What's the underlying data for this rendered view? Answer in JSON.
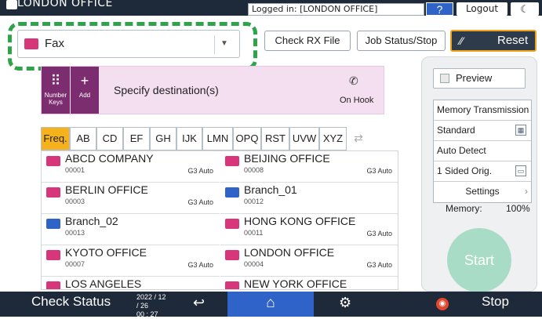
{
  "topbar": {
    "office_label": "LONDON OFFICE",
    "logged_in": "Logged in: [LONDON OFFICE]",
    "help": "?",
    "logout": "Logout",
    "moon": "☾"
  },
  "func_select": {
    "label": "Fax",
    "caret": "▼"
  },
  "buttons": {
    "check_rx": "Check RX File",
    "job_status": "Job Status/Stop",
    "reset": "Reset",
    "reset_icon": "⁄⁄"
  },
  "dest_header": {
    "numkeys_label": "Number Keys",
    "add_label": "Add",
    "specify": "Specify destination(s)",
    "onhook": "On Hook",
    "phone_icon": "✆"
  },
  "tabs": [
    "Freq.",
    "AB",
    "CD",
    "EF",
    "GH",
    "IJK",
    "LMN",
    "OPQ",
    "RST",
    "UVW",
    "XYZ"
  ],
  "tab_swap": "⇄",
  "destinations": [
    {
      "name": "ABCD COMPANY",
      "num": "00001",
      "mode": "G3 Auto",
      "group": false
    },
    {
      "name": "BEIJING OFFICE",
      "num": "00008",
      "mode": "G3 Auto",
      "group": false
    },
    {
      "name": "BERLIN OFFICE",
      "num": "00003",
      "mode": "G3 Auto",
      "group": false
    },
    {
      "name": "Branch_01",
      "num": "00012",
      "mode": "",
      "group": true
    },
    {
      "name": "Branch_02",
      "num": "00013",
      "mode": "",
      "group": true
    },
    {
      "name": "HONG KONG OFFICE",
      "num": "00011",
      "mode": "G3 Auto",
      "group": false
    },
    {
      "name": "KYOTO OFFICE",
      "num": "00007",
      "mode": "G3 Auto",
      "group": false
    },
    {
      "name": "LONDON OFFICE",
      "num": "00004",
      "mode": "G3 Auto",
      "group": false
    },
    {
      "name": "LOS ANGELES",
      "num": "",
      "mode": "",
      "group": false
    },
    {
      "name": "NEW YORK OFFICE",
      "num": "",
      "mode": "",
      "group": false
    }
  ],
  "right_panel": {
    "preview": "Preview",
    "memory_tx": "Memory Transmission",
    "standard": "Standard",
    "auto_detect": "Auto Detect",
    "sided": "1 Sided Orig.",
    "settings": "Settings",
    "memory_label": "Memory:",
    "memory_value": "100%",
    "start": "Start"
  },
  "bottombar": {
    "check_status": "Check Status",
    "date": "2022 / 12 / 26",
    "time": "00 : 27",
    "stop": "Stop"
  },
  "colors": {
    "accent_blue": "#2f63c8",
    "fax_pink": "#d8367a",
    "reset_border": "#f0a21a",
    "active_tab": "#f6b21c",
    "dashed_frame": "#2ea34a"
  }
}
